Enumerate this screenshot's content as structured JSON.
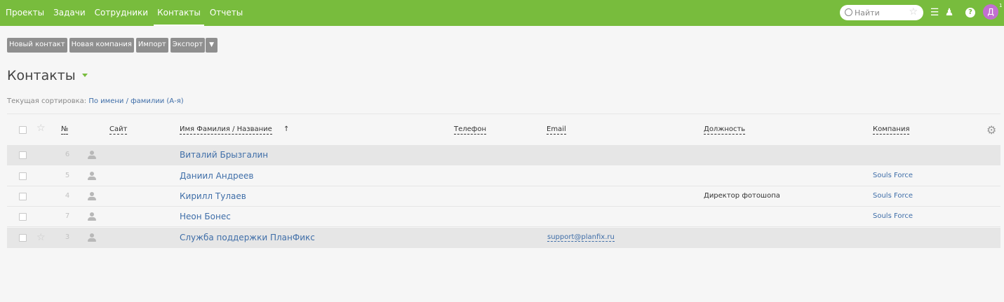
{
  "nav": [
    "Проекты",
    "Задачи",
    "Сотрудники",
    "Контакты",
    "Отчеты"
  ],
  "nav_active": 3,
  "search": {
    "placeholder": "Найти"
  },
  "user": {
    "avatar_letter": "Д",
    "badge": "1"
  },
  "toolbar": {
    "new_contact": "Новый контакт",
    "new_company": "Новая компания",
    "import": "Импорт",
    "export": "Экспорт",
    "more": "▼"
  },
  "page_title": "Контакты",
  "sort": {
    "label": "Текущая сортировка:",
    "value": "По имени / фамилии (А-я)"
  },
  "columns": {
    "number": "№",
    "site": "Сайт",
    "name": "Имя Фамилия / Название",
    "name_sort_arrow": "↑",
    "phone": "Телефон",
    "email": "Email",
    "position": "Должность",
    "company": "Компания"
  },
  "rows": [
    {
      "num": "6",
      "name": "Виталий Брызгалин",
      "email": "",
      "position": "",
      "company": ""
    },
    {
      "num": "5",
      "name": "Даниил Андреев",
      "email": "",
      "position": "",
      "company": "Souls Force"
    },
    {
      "num": "4",
      "name": "Кирилл Тулаев",
      "email": "",
      "position": "Директор фотошопа",
      "company": "Souls Force"
    },
    {
      "num": "7",
      "name": "Неон Бонес",
      "email": "",
      "position": "",
      "company": "Souls Force"
    },
    {
      "num": "3",
      "name": "Служба поддержки ПланФикс",
      "email": "support@planfix.ru",
      "position": "",
      "company": ""
    }
  ],
  "colors": {
    "brand": "#78bc3d",
    "link": "#3f6ea8",
    "button": "#8f8f8f"
  }
}
